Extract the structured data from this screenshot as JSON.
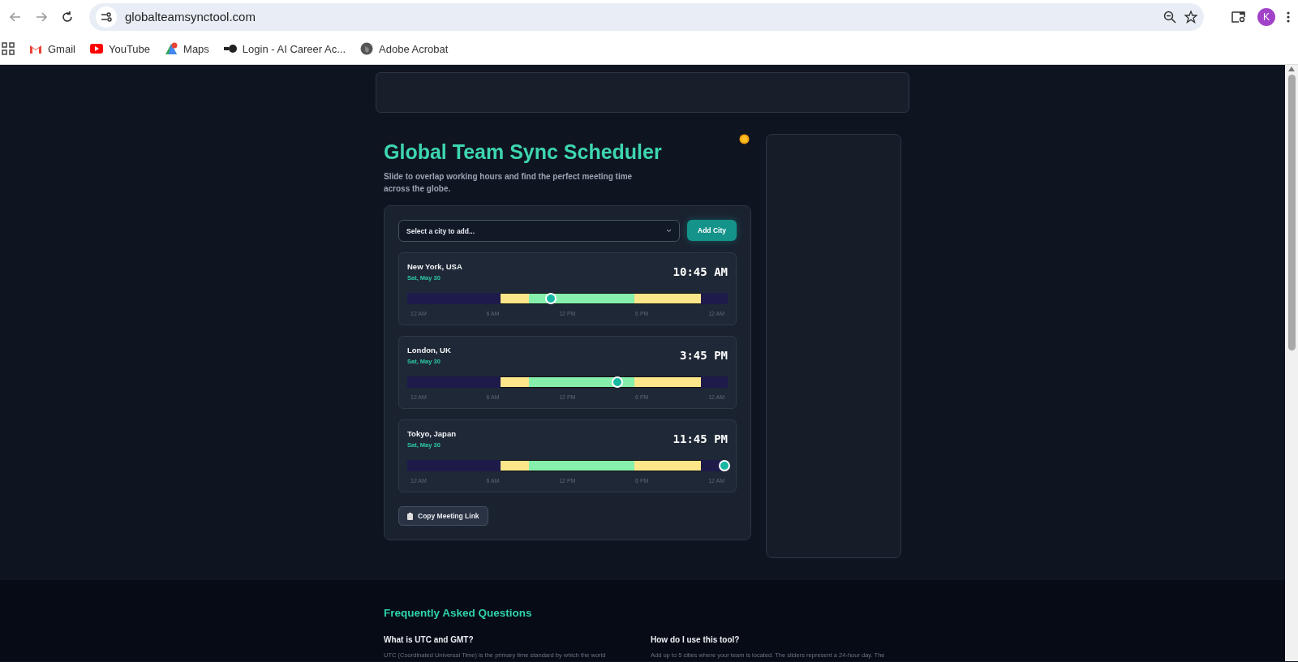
{
  "browser": {
    "url": "globalteamsynctool.com",
    "profile_initial": "K"
  },
  "bookmarks": [
    {
      "kind": "gmail",
      "label": "Gmail"
    },
    {
      "kind": "youtube",
      "label": "YouTube"
    },
    {
      "kind": "maps",
      "label": "Maps"
    },
    {
      "kind": "login",
      "label": "Login - AI Career Ac..."
    },
    {
      "kind": "globe",
      "label": "Adobe Acrobat"
    }
  ],
  "header": {
    "title": "Global Team Sync Scheduler",
    "subtitle": "Slide to overlap working hours and find the perfect meeting time across the globe."
  },
  "city_picker": {
    "placeholder": "Select a city to add...",
    "button": "Add City"
  },
  "cities": [
    {
      "name": "New York, USA",
      "date": "Sat, May 30",
      "time": "10:45 AM",
      "level": 0.448,
      "ticks": [
        "12 AM",
        "6 AM",
        "12 PM",
        "6 PM",
        "12 AM"
      ]
    },
    {
      "name": "London, UK",
      "date": "Sat, May 30",
      "time": "3:45 PM",
      "level": 0.656,
      "ticks": [
        "12 AM",
        "6 AM",
        "12 PM",
        "6 PM",
        "12 AM"
      ]
    },
    {
      "name": "Tokyo, Japan",
      "date": "Sat, May 30",
      "time": "11:45 PM",
      "level": 0.99,
      "ticks": [
        "12 AM",
        "6 AM",
        "12 PM",
        "6 PM",
        "12 AM"
      ]
    }
  ],
  "copy_button": "Copy Meeting Link",
  "faq": {
    "title": "Frequently Asked Questions",
    "items": [
      {
        "question": "What is UTC and GMT?",
        "answer": "UTC (Coordinated Universal Time) is the primary time standard by which the world"
      },
      {
        "question": "How do I use this tool?",
        "answer": "Add up to 5 cities where your team is located. The sliders represent a 24-hour day. The"
      }
    ]
  }
}
